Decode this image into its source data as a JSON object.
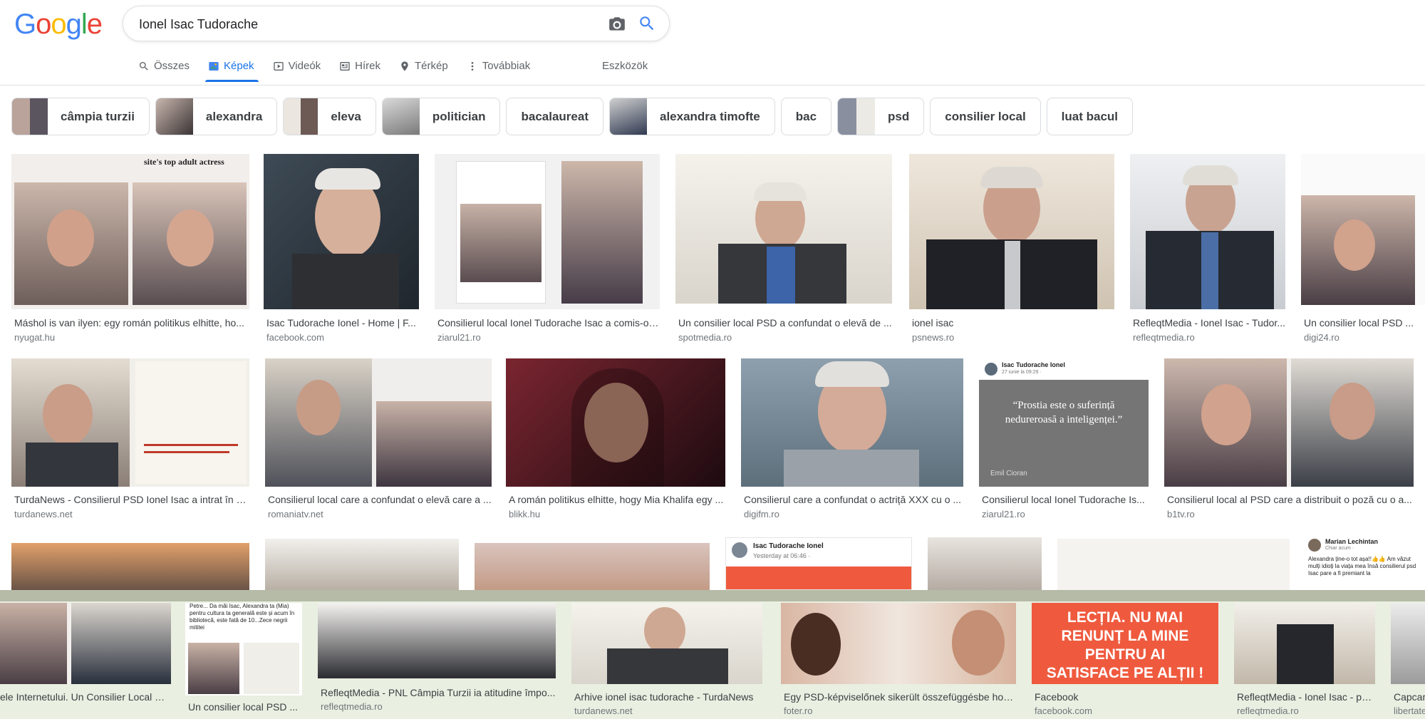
{
  "logo": [
    "G",
    "o",
    "o",
    "g",
    "l",
    "e"
  ],
  "logo_colors": [
    "#4285f4",
    "#ea4335",
    "#fbbc05",
    "#4285f4",
    "#34a853",
    "#ea4335"
  ],
  "search": {
    "value": "Ionel Isac Tudorache"
  },
  "tabs": [
    {
      "label": "Összes",
      "icon": "search-icon"
    },
    {
      "label": "Képek",
      "icon": "images-icon"
    },
    {
      "label": "Videók",
      "icon": "play-icon"
    },
    {
      "label": "Hírek",
      "icon": "news-icon"
    },
    {
      "label": "Térkép",
      "icon": "map-pin-icon"
    },
    {
      "label": "Továbbiak",
      "icon": "more-vert-icon"
    }
  ],
  "tools_label": "Eszközök",
  "chips": [
    "câmpia turzii",
    "alexandra",
    "eleva",
    "politician",
    "bacalaureat",
    "alexandra timofte",
    "bac",
    "psd",
    "consilier local",
    "luat bacul"
  ],
  "results_row1": [
    {
      "caption": "Máshol is van ilyen: egy román politikus elhitte, ho...",
      "source": "nyugat.hu"
    },
    {
      "caption": "Isac Tudorache Ionel - Home | F...",
      "source": "facebook.com"
    },
    {
      "caption": "Consilierul local Ionel Tudorache Isac a comis-o ...",
      "source": "ziarul21.ro"
    },
    {
      "caption": "Un consilier local PSD a confundat o elevă de ...",
      "source": "spotmedia.ro"
    },
    {
      "caption": "ionel isac",
      "source": "psnews.ro"
    },
    {
      "caption": "RefleqtMedia - Ionel Isac - Tudor...",
      "source": "refleqtmedia.ro"
    },
    {
      "caption": "Un consilier local PSD ...",
      "source": "digi24.ro"
    }
  ],
  "results_row2": [
    {
      "caption": "TurdaNews - Consilierul PSD Ionel Isac a intrat în di...",
      "source": "turdanews.net"
    },
    {
      "caption": "Consilierul local care a confundat o elevă care a ...",
      "source": "romaniatv.net"
    },
    {
      "caption": "A román politikus elhitte, hogy Mia Khalifa egy ...",
      "source": "blikk.hu"
    },
    {
      "caption": "Consilierul care a confundat o actriță XXX cu o ...",
      "source": "digifm.ro"
    },
    {
      "caption": "Consilierul local Ionel Tudorache Is...",
      "source": "ziarul21.ro"
    },
    {
      "caption": "Consilierul local al PSD care a distribuit o poză cu o a...",
      "source": "b1tv.ro"
    }
  ],
  "row2_card": {
    "author": "Isac Tudorache Ionel",
    "date": "27 iunie la 09:29 · ",
    "quote": "“Prostia este o suferință nedureroasă a inteligenței.”",
    "attribution": "Emil Cioran"
  },
  "row3_cards": {
    "fb_author": "Isac Tudorache Ionel",
    "fb_time": "Yesterday at 06:46 · ",
    "ml_author": "Marian Lechintan",
    "ml_time": "Chiar acum · ",
    "ml_text": "Alexandra ține-o tot așa!!👍👍 Am văzut mulți idioți la viața mea însă consilierul psd Isac pare a fi premiant la"
  },
  "overlay_results": [
    {
      "caption": "ele Internetului. Un Consilier Local P...",
      "source": ""
    },
    {
      "caption": "Un consilier local PSD ...",
      "source": ""
    },
    {
      "caption": "RefleqtMedia - PNL Câmpia Turzii ia atitudine împo...",
      "source": "refleqtmedia.ro"
    },
    {
      "caption": "Arhive ionel isac tudorache - TurdaNews",
      "source": "turdanews.net"
    },
    {
      "caption": "Egy PSD-képviselőnek sikerült összefüggésbe hozni...",
      "source": "foter.ro"
    },
    {
      "caption": "Facebook",
      "source": "facebook.com"
    },
    {
      "caption": "RefleqtMedia - Ionel Isac - pa...",
      "source": "refleqtmedia.ro"
    },
    {
      "caption": "Capcar",
      "source": "libertate"
    }
  ],
  "overlay_card": {
    "text": "Petre... Da măi Isac, Alexandra ta (Mia) pentru cultura ta generală este și acum în bibliotecă, este fată de 10...Zece negrii mititei"
  },
  "poster_text": "LECȚIA. NU MAI RENUNȚ LA MINE PENTRU AI SATISFACE PE ALȚII !"
}
